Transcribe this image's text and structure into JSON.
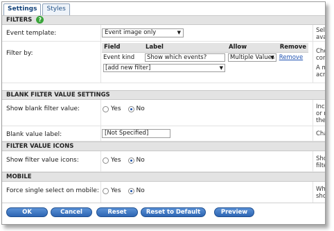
{
  "tabs": [
    {
      "label": "Settings",
      "active": true
    },
    {
      "label": "Styles",
      "active": false
    }
  ],
  "sections": {
    "filters": "FILTERS",
    "help_icon": "?",
    "blank": "BLANK FILTER VALUE SETTINGS",
    "icons": "FILTER VALUE ICONS",
    "mobile": "MOBILE"
  },
  "rows": {
    "event_template": {
      "label": "Event template:",
      "value": "Event image only",
      "desc1": "Sele",
      "desc2": "ava"
    },
    "filter_by": {
      "label": "Filter by:",
      "desc1": "Choo",
      "desc2": "conf",
      "desc3": "A ma",
      "desc4": "acro"
    },
    "show_blank": {
      "label": "Show blank filter value:",
      "yes": "Yes",
      "no": "No",
      "selected": "No",
      "desc1": "Incl",
      "desc2": "or m",
      "desc3": "the"
    },
    "blank_label": {
      "label": "Blank value label:",
      "value": "[Not Specified]",
      "desc1": "Cha"
    },
    "show_icons": {
      "label": "Show filter value icons:",
      "yes": "Yes",
      "no": "No",
      "selected": "No",
      "desc1": "Sho",
      "desc2": "filte"
    },
    "force_single": {
      "label": "Force single select on mobile:",
      "yes": "Yes",
      "no": "No",
      "selected": "No",
      "desc1": "Whe",
      "desc2": "sho"
    }
  },
  "filter_table": {
    "headers": {
      "field": "Field",
      "label": "Label",
      "allow": "Allow",
      "remove": "Remove"
    },
    "row": {
      "field": "Event kind",
      "label": "Show which events?",
      "allow": "Multiple Values",
      "remove": "Remove"
    },
    "add_new": "[add new filter]"
  },
  "buttons": {
    "ok": "OK",
    "cancel": "Cancel",
    "reset": "Reset",
    "reset_default": "Reset to Default",
    "preview": "Preview"
  },
  "icons": {
    "dropdown": "chevron-down-icon",
    "help": "help-icon"
  },
  "colors": {
    "button": "#2d65b3",
    "section_bg": "#e3e3e3",
    "help_icon": "#3aa43a",
    "link": "#1c4fb0"
  }
}
